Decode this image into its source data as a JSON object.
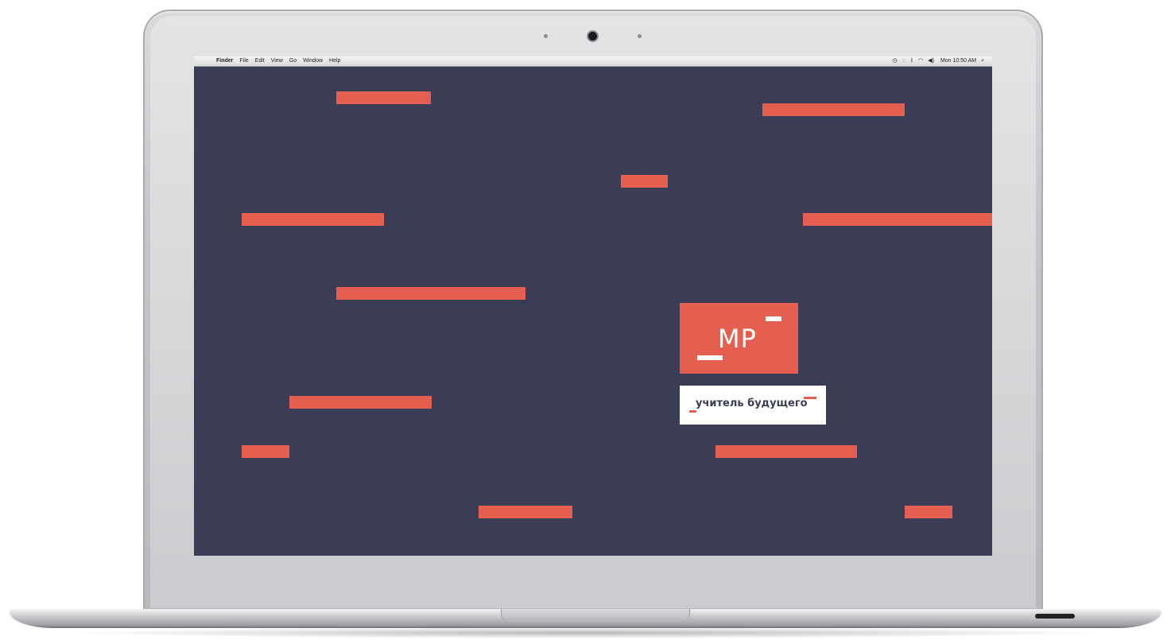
{
  "menubar": {
    "apple_symbol": "",
    "app_name": "Finder",
    "items": [
      "File",
      "Edit",
      "View",
      "Go",
      "Window",
      "Help"
    ],
    "status_icons": [
      "time-machine-icon",
      "sync-icon",
      "bluetooth-icon",
      "wifi-icon",
      "volume-icon"
    ],
    "clock": "Mon 10:50 AM",
    "search_symbol": "⌕"
  },
  "wallpaper": {
    "background_color": "#3b3c55",
    "bar_color": "#e45f50"
  },
  "logo": {
    "mark": "MP",
    "tagline": "учитель будущего",
    "box_color": "#e45f50"
  }
}
